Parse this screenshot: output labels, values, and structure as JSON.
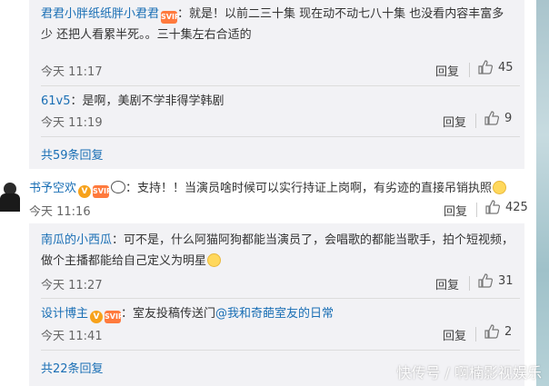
{
  "thread1": {
    "comments": [
      {
        "user": "君君小胖纸纸胖小君君",
        "line1": "：就是！以前二三十集 现在动不动七八十集 也没看内容丰富多",
        "line2": "少 还把人看累半死。。三十集左右合适的",
        "time": "今天 11:17",
        "reply": "回复",
        "likes": "45"
      },
      {
        "user": "61v5",
        "line1": "：是啊，美剧不学非得学韩剧",
        "time": "今天 11:19",
        "reply": "回复",
        "likes": "9"
      }
    ],
    "more": "共59条回复"
  },
  "main_comment": {
    "user": "书予空欢",
    "text": "：支持！！当演员啥时候可以实行持证上岗啊，有劣迹的直接吊销执照",
    "time": "今天 11:16",
    "reply": "回复",
    "likes": "425"
  },
  "thread2": {
    "comments": [
      {
        "user": "南瓜的小西瓜",
        "line1": "：可不是，什么阿猫阿狗都能当演员了，会唱歌的都能当歌手，拍个短视频，",
        "line2": "做个主播都能给自己定义为明星",
        "time": "今天 11:27",
        "reply": "回复",
        "likes": "31"
      },
      {
        "user": "设计博主",
        "text_before": "：室友投稿传送门",
        "mention": "@我和奇葩室友的日常",
        "time": "今天 11:41",
        "reply": "回复",
        "likes": "2"
      }
    ],
    "more": "共22条回复"
  },
  "badges": {
    "v": "V",
    "svip": "SVIP"
  },
  "watermark": "快传号 / 啊楠影视娱乐",
  "colors": {
    "link": "#1a6fb5",
    "thread_bg": "#f2f2f5",
    "badge_orange": "#f7a21b"
  }
}
